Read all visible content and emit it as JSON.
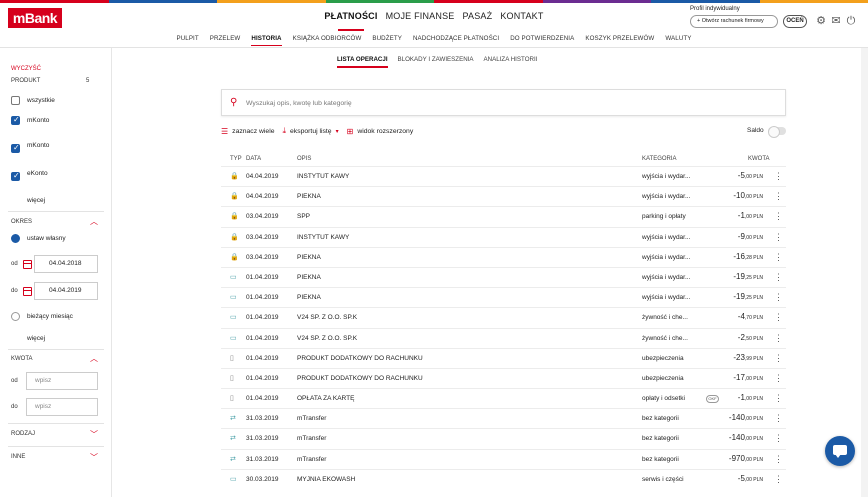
{
  "brand": {
    "logo": "mBank",
    "stripe_colors": [
      "#d6001c",
      "#1b5aa6",
      "#f3a01c",
      "#2a9d4a",
      "#d6001c",
      "#6b2c91",
      "#1b5aa6",
      "#f3a01c"
    ]
  },
  "main_nav": [
    "PŁATNOŚCI",
    "MOJE FINANSE",
    "PASAŻ",
    "KONTAKT"
  ],
  "main_nav_active": 0,
  "profile": {
    "label": "Profil indywidualny",
    "open_account": "+ Otwórz rachunek firmowy",
    "rate": "OCEŃ"
  },
  "icons": {
    "settings": "gear-icon",
    "mail": "mail-icon",
    "logout": "power-icon"
  },
  "sub_nav": [
    "PULPIT",
    "PRZELEW",
    "HISTORIA",
    "KSIĄŻKA ODBIORCÓW",
    "BUDŻETY",
    "NADCHODZĄCE PŁATNOŚCI",
    "DO POTWIERDZENIA",
    "KOSZYK PRZELEWÓW",
    "WALUTY"
  ],
  "sub_nav_active": 2,
  "tabs": [
    "LISTA OPERACJI",
    "BLOKADY I ZAWIESZENIA",
    "ANALIZA HISTORII"
  ],
  "tabs_active": 0,
  "sidebar": {
    "clear": "WYCZYŚĆ",
    "product_head": "PRODUKT",
    "product_count": "5",
    "products": [
      {
        "label": "wszystkie",
        "checked": false
      },
      {
        "label": "mKonto",
        "checked": true
      },
      {
        "label": "mKonto",
        "checked": true
      },
      {
        "label": "eKonto",
        "checked": true
      }
    ],
    "more": "więcej",
    "period_head": "OKRES",
    "custom": "ustaw własny",
    "from_label": "od",
    "from_value": "04.04.2018",
    "to_label": "do",
    "to_value": "04.04.2019",
    "current_month": "bieżący miesiąc",
    "more2": "więcej",
    "amount_head": "KWOTA",
    "amt_from_label": "od",
    "amt_from_placeholder": "wpisz",
    "amt_to_label": "do",
    "amt_to_placeholder": "wpisz",
    "type_head": "RODZAJ",
    "other_head": "INNE"
  },
  "search": {
    "placeholder": "Wyszukaj opis, kwotę lub kategorię"
  },
  "actions": {
    "select_many": "zaznacz wiele",
    "export": "eksportuj listę",
    "extended": "widok rozszerzony",
    "saldo": "Saldo"
  },
  "table": {
    "headers": {
      "typ": "TYP",
      "data": "DATA",
      "opis": "OPIS",
      "kategoria": "KATEGORIA",
      "kwota": "KWOTA"
    },
    "rows": [
      {
        "type": "lock",
        "date": "04.04.2019",
        "desc": "INSTYTUT KAWY",
        "cat": "wyjścia i wydar...",
        "amt": "-5",
        "dec": ",00 PLN"
      },
      {
        "type": "lock",
        "date": "04.04.2019",
        "desc": "PIEKNA",
        "cat": "wyjścia i wydar...",
        "amt": "-10",
        "dec": ",00 PLN"
      },
      {
        "type": "lock",
        "date": "03.04.2019",
        "desc": "SPP",
        "cat": "parking i opłaty",
        "amt": "-1",
        "dec": ",00 PLN"
      },
      {
        "type": "lock",
        "date": "03.04.2019",
        "desc": "INSTYTUT KAWY",
        "cat": "wyjścia i wydar...",
        "amt": "-9",
        "dec": ",00 PLN"
      },
      {
        "type": "lock",
        "date": "03.04.2019",
        "desc": "PIEKNA",
        "cat": "wyjścia i wydar...",
        "amt": "-16",
        "dec": ",28 PLN"
      },
      {
        "type": "card",
        "date": "01.04.2019",
        "desc": "PIEKNA",
        "cat": "wyjścia i wydar...",
        "amt": "-19",
        "dec": ",25 PLN"
      },
      {
        "type": "card",
        "date": "01.04.2019",
        "desc": "PIEKNA",
        "cat": "wyjścia i wydar...",
        "amt": "-19",
        "dec": ",25 PLN"
      },
      {
        "type": "card",
        "date": "01.04.2019",
        "desc": "V24 SP. Z O.O. SP.K",
        "cat": "żywność i che...",
        "amt": "-4",
        "dec": ",70 PLN"
      },
      {
        "type": "card",
        "date": "01.04.2019",
        "desc": "V24 SP. Z O.O. SP.K",
        "cat": "żywność i che...",
        "amt": "-2",
        "dec": ",50 PLN"
      },
      {
        "type": "doc",
        "date": "01.04.2019",
        "desc": "PRODUKT DODATKOWY DO RACHUNKU",
        "cat": "ubezpieczenia",
        "amt": "-23",
        "dec": ",99 PLN"
      },
      {
        "type": "doc",
        "date": "01.04.2019",
        "desc": "PRODUKT DODATKOWY DO RACHUNKU",
        "cat": "ubezpieczenia",
        "amt": "-17",
        "dec": ",00 PLN"
      },
      {
        "type": "doc",
        "date": "01.04.2019",
        "desc": "OPŁATA ZA KARTĘ",
        "cat": "opłaty i odsetki",
        "amt": "-1",
        "dec": ",00 PLN",
        "tag": "OKF"
      },
      {
        "type": "trf",
        "date": "31.03.2019",
        "desc": "mTransfer",
        "cat": "bez kategorii",
        "amt": "-140",
        "dec": ",00 PLN"
      },
      {
        "type": "trf",
        "date": "31.03.2019",
        "desc": "mTransfer",
        "cat": "bez kategorii",
        "amt": "-140",
        "dec": ",00 PLN"
      },
      {
        "type": "trf",
        "date": "31.03.2019",
        "desc": "mTransfer",
        "cat": "bez kategorii",
        "amt": "-970",
        "dec": ",00 PLN"
      },
      {
        "type": "card",
        "date": "30.03.2019",
        "desc": "MYJNIA EKOWASH",
        "cat": "serwis i części",
        "amt": "-5",
        "dec": ",00 PLN"
      }
    ]
  }
}
